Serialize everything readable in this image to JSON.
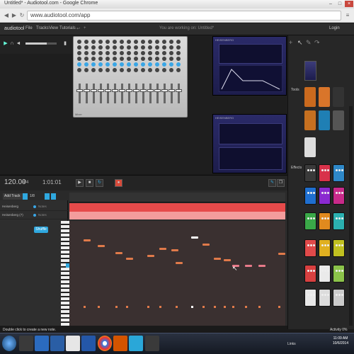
{
  "browser": {
    "tab_title": "Untitled* - Audiotool.com - Google Chrome",
    "url": "www.audiotool.com/app"
  },
  "app": {
    "logo": "audiotool",
    "menu": [
      "File",
      "Tracks",
      "View",
      "Tutorials"
    ],
    "status": "You are working on: Untitled*",
    "login": "Login"
  },
  "desk": {
    "mixer_label": "Mixer",
    "synth_top_name": "HEISENBERG",
    "synth_bottom_name": "HEISENBERG"
  },
  "right_panel": {
    "tools_label": "Tools",
    "effects_label": "Effects"
  },
  "sequencer": {
    "bpm": "120.00",
    "signature": "4/4",
    "time": "1:01:01",
    "add_track": "Add Track",
    "grid": "1/8",
    "tracks": [
      {
        "name": "Heisenberg",
        "notes": "Notes"
      },
      {
        "name": "Heisenberg (7)",
        "notes": "Notes"
      }
    ],
    "shuffle": "Shuffle",
    "hint": "Double click to create a new note.",
    "activity": "Activity 0%"
  },
  "taskbar": {
    "links": "Links",
    "time": "11:09 AM",
    "date": "10/6/2014"
  },
  "colors": {
    "accent": "#2fa8df",
    "region_red": "#e64a4a",
    "region_pink": "#f39c9c",
    "note": "#e07a4a"
  }
}
